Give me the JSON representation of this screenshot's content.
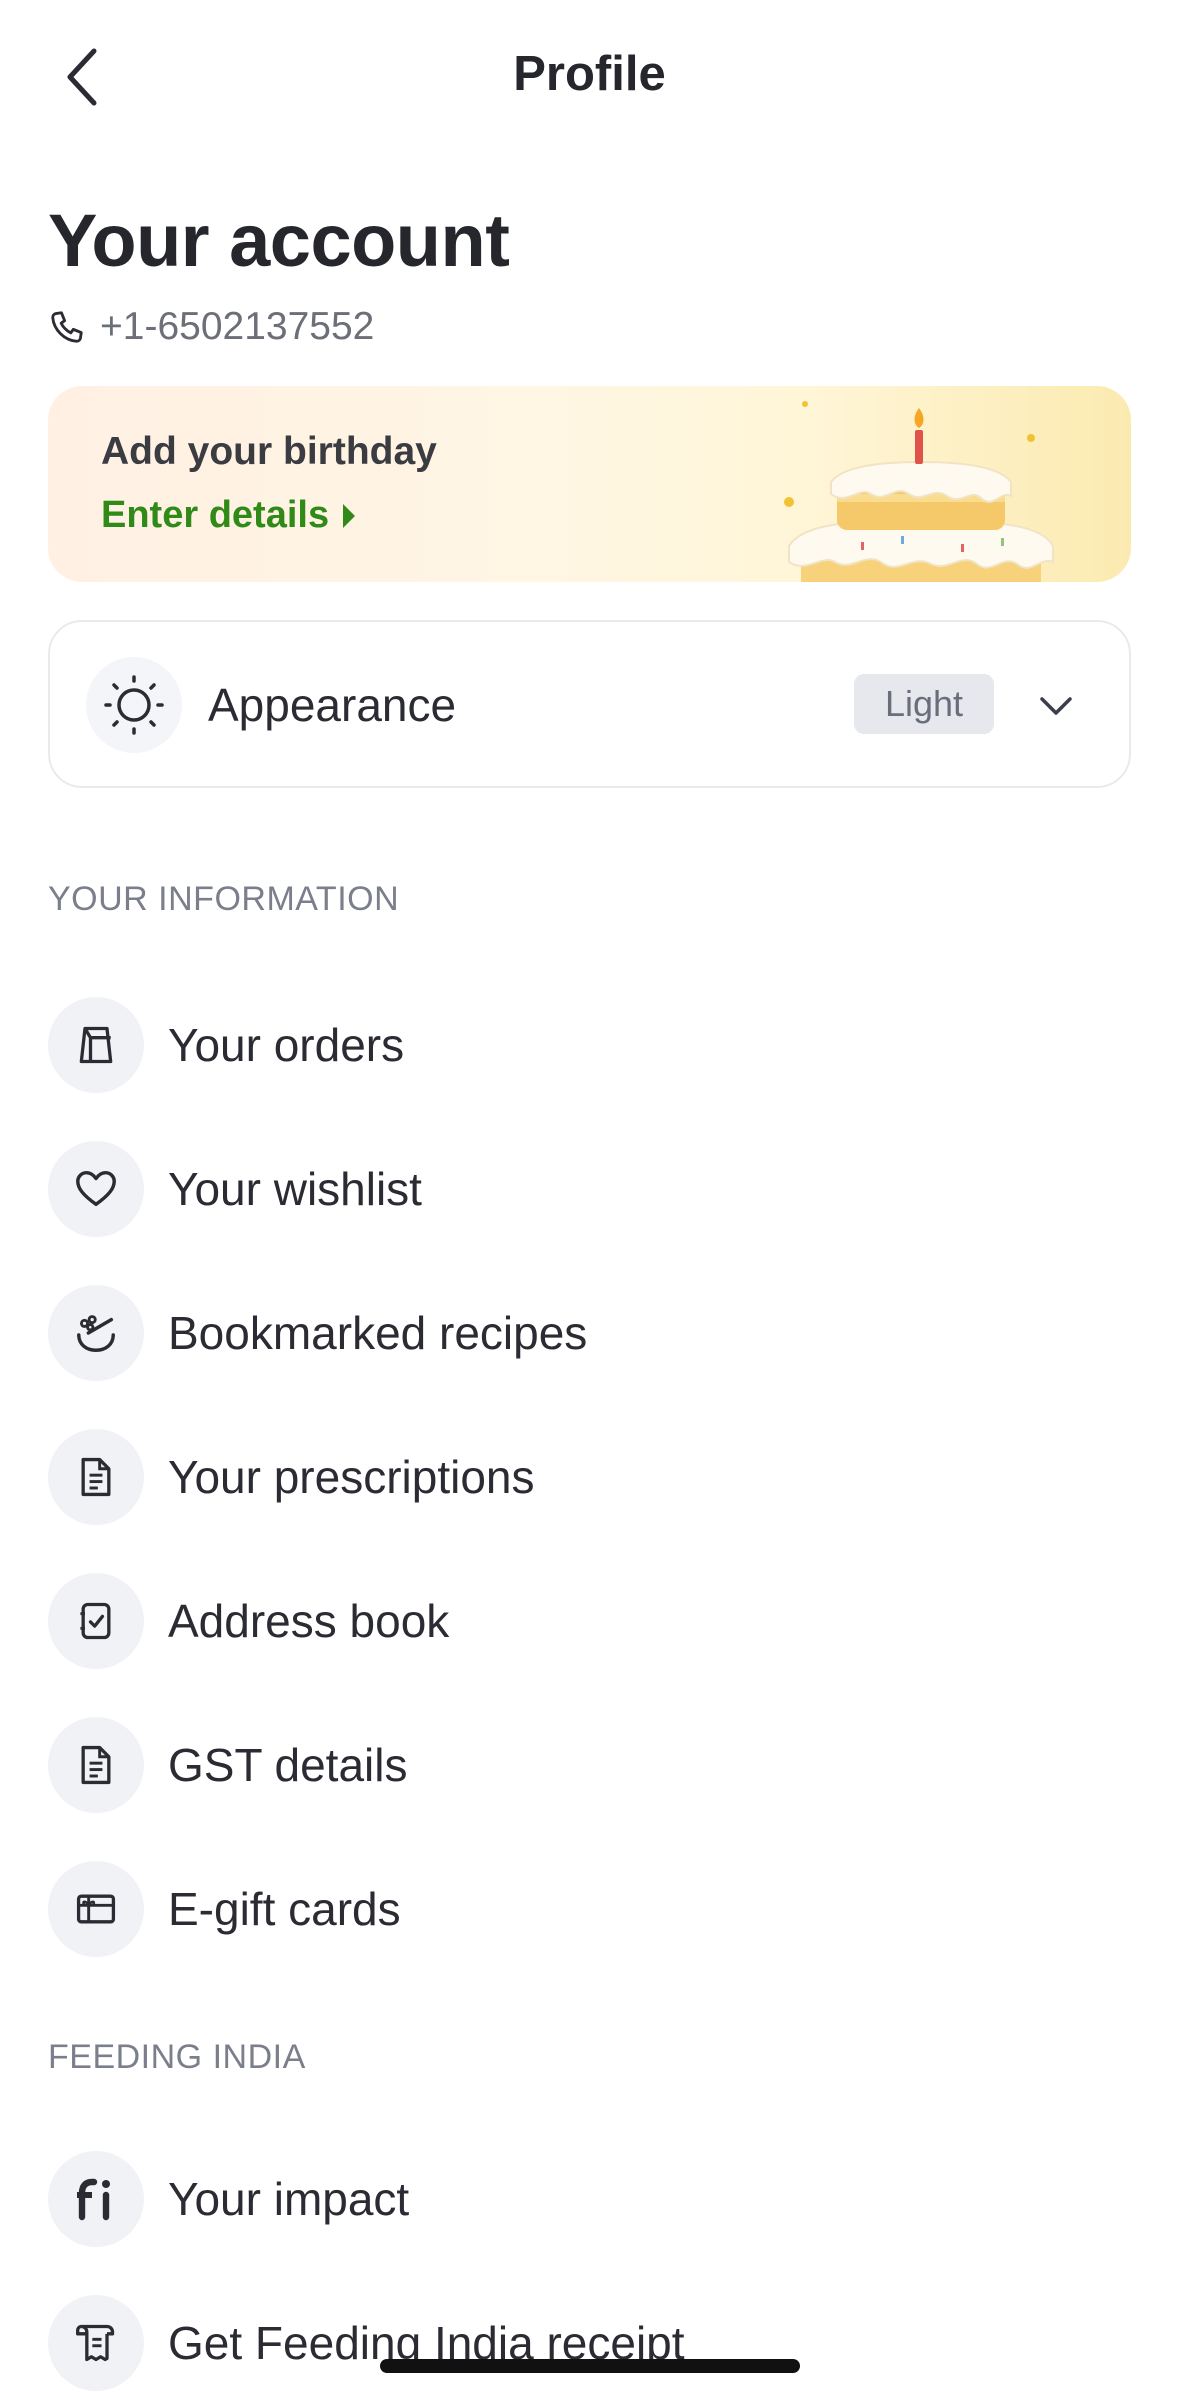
{
  "header": {
    "title": "Profile",
    "back_icon": "chevron-left-icon"
  },
  "account": {
    "title": "Your account",
    "phone": "+1-6502137552",
    "phone_icon": "phone-icon"
  },
  "birthday": {
    "title": "Add your birthday",
    "link": "Enter details"
  },
  "appearance": {
    "label": "Appearance",
    "value": "Light",
    "icon": "sun-icon"
  },
  "sections": [
    {
      "title": "YOUR INFORMATION",
      "items": [
        {
          "label": "Your orders",
          "icon": "bag-icon"
        },
        {
          "label": "Your wishlist",
          "icon": "heart-icon"
        },
        {
          "label": "Bookmarked recipes",
          "icon": "recipe-bowl-icon"
        },
        {
          "label": "Your prescriptions",
          "icon": "document-icon"
        },
        {
          "label": "Address book",
          "icon": "address-book-icon"
        },
        {
          "label": "GST details",
          "icon": "document-icon"
        },
        {
          "label": "E-gift cards",
          "icon": "gift-card-icon"
        }
      ]
    },
    {
      "title": "FEEDING INDIA",
      "items": [
        {
          "label": "Your impact",
          "icon": "feeding-india-logo-icon"
        },
        {
          "label": "Get Feeding India receipt",
          "icon": "receipt-icon"
        }
      ]
    }
  ],
  "colors": {
    "accent_green": "#2f8a18",
    "muted_text": "#7b7f8c",
    "icon_bg": "#f1f2f6"
  }
}
